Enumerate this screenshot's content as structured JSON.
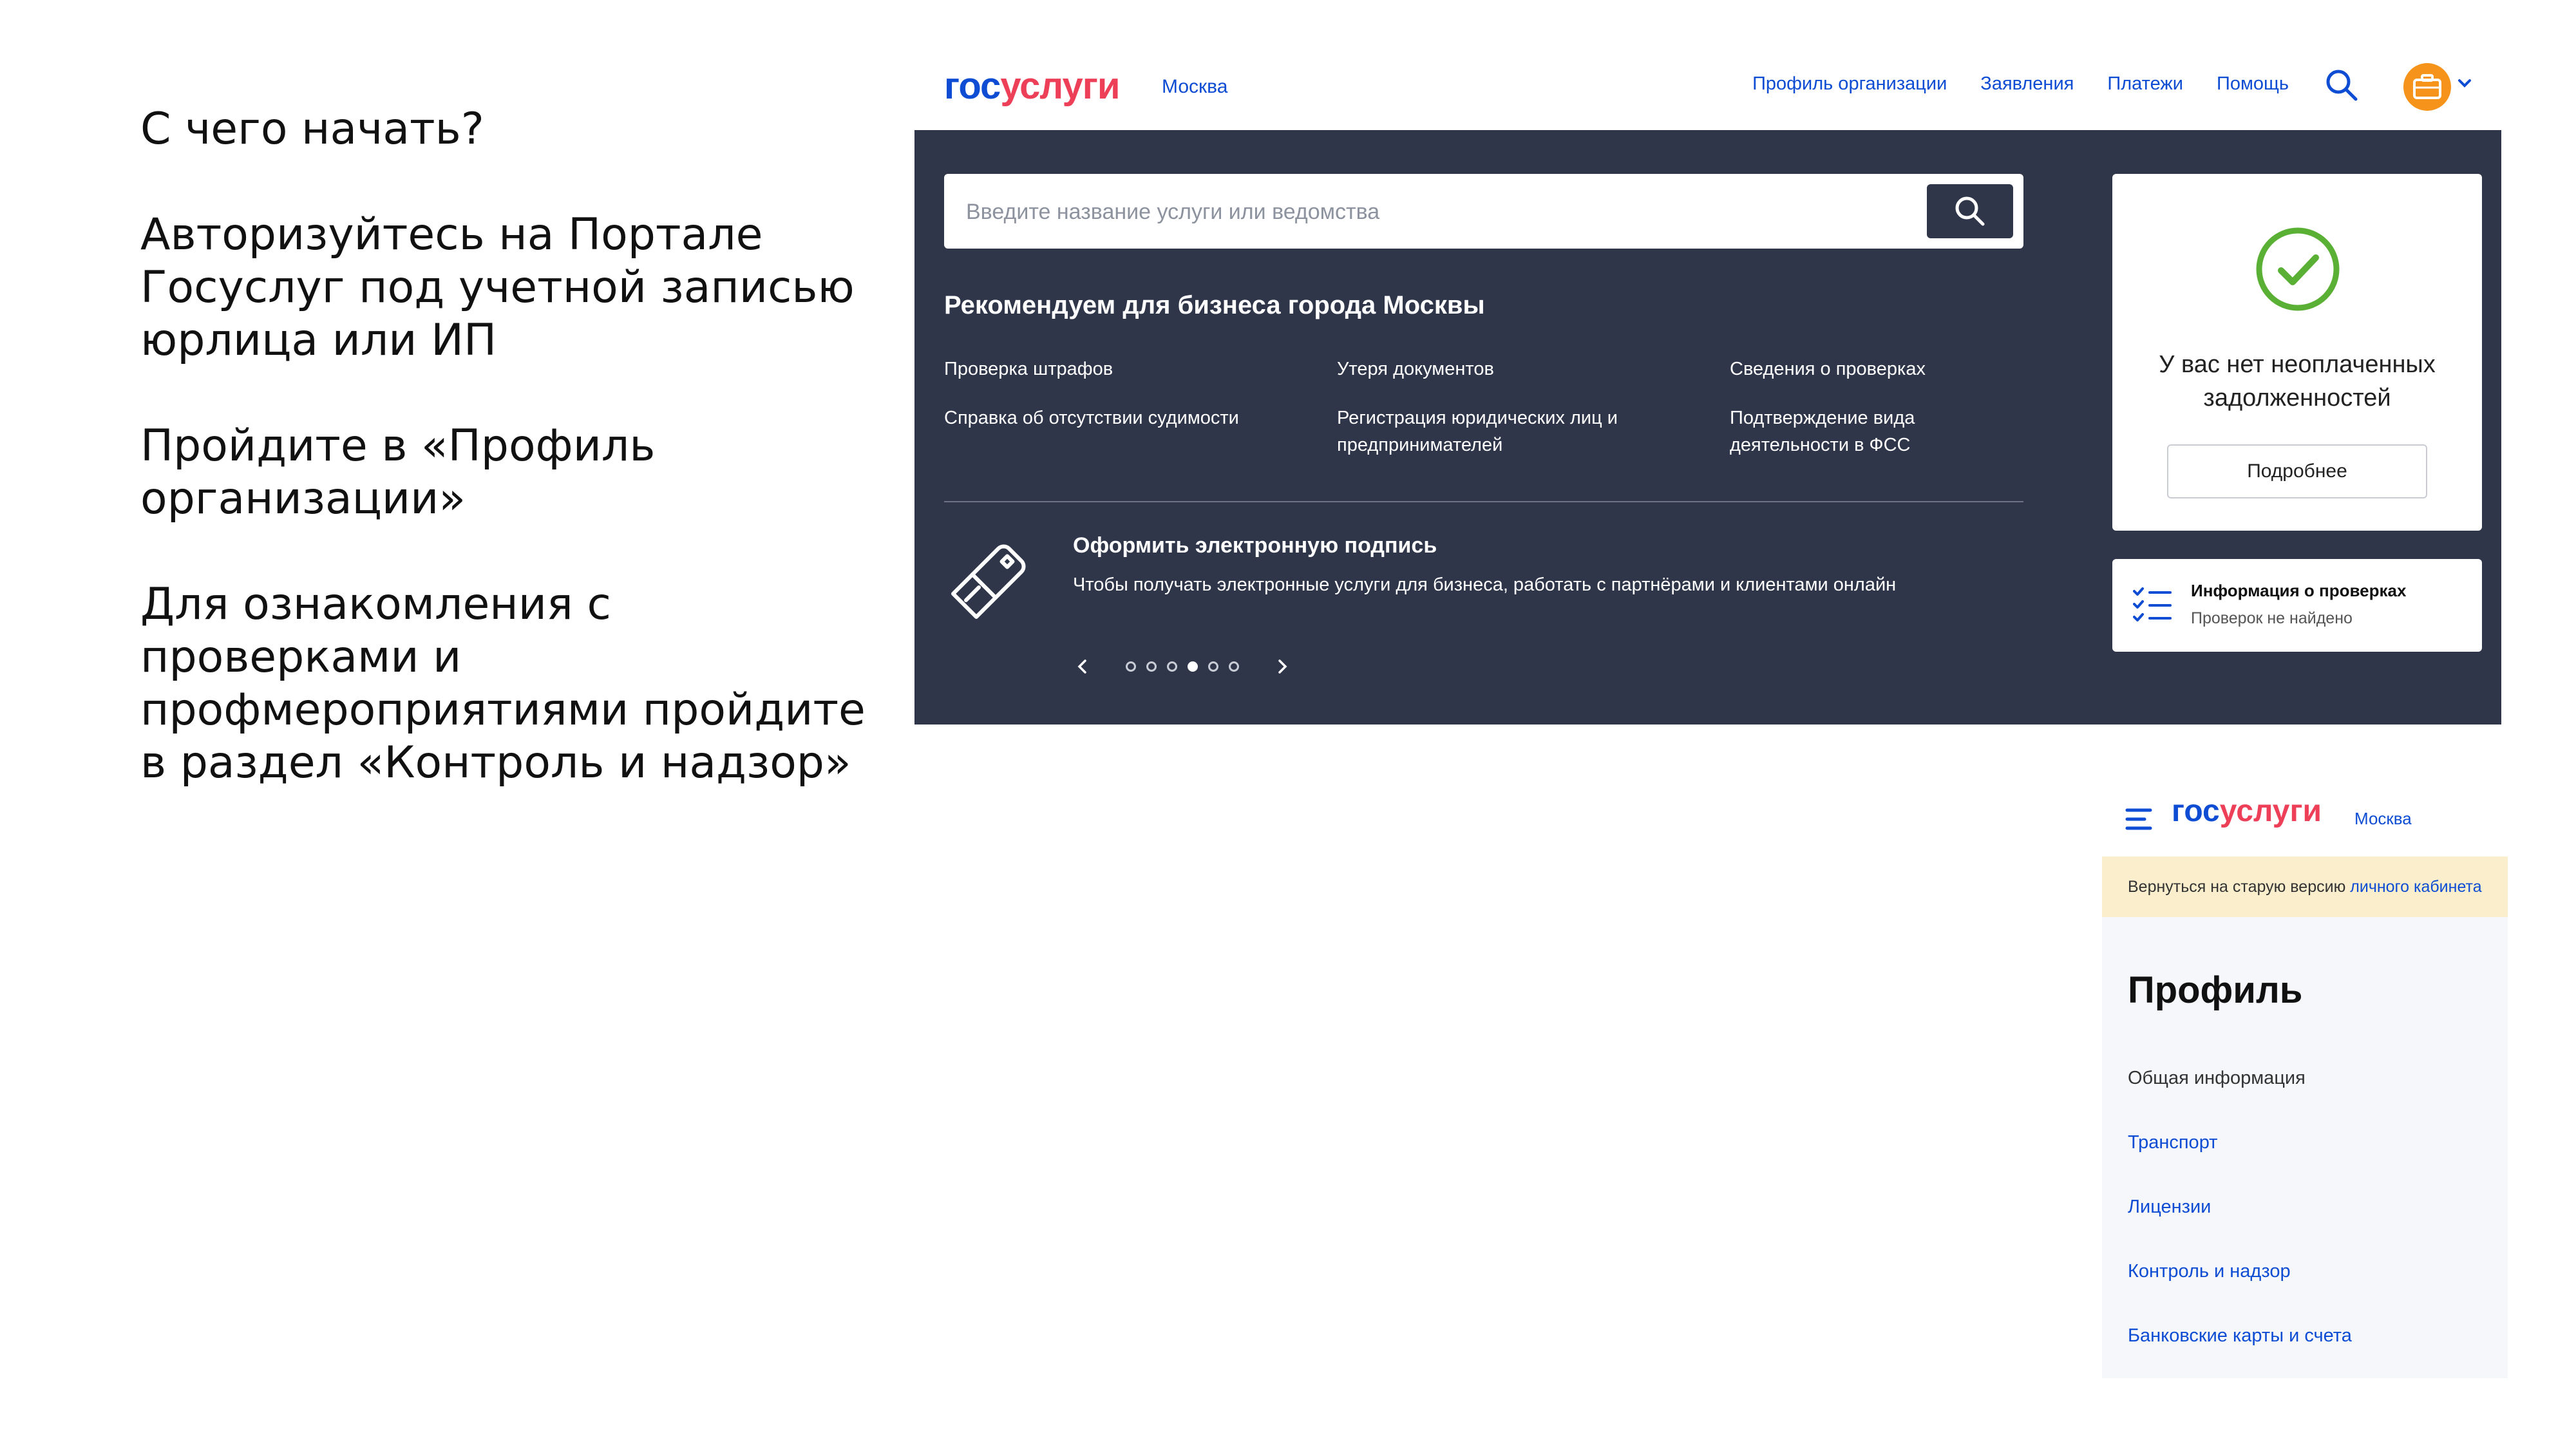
{
  "slide": {
    "heading": "С чего начать?",
    "step1": "Авторизуйтесь на Портале Госуслуг под учетной записью юрлица или ИП",
    "step2": "Пройдите в «Профиль организации»",
    "step3": "Для ознакомления с проверками и профмероприятиями пройдите в раздел «Контроль и надзор»"
  },
  "header": {
    "logo_part1": "гос",
    "logo_part2": "услуги",
    "city": "Москва",
    "nav": [
      "Профиль организации",
      "Заявления",
      "Платежи",
      "Помощь"
    ]
  },
  "search": {
    "placeholder": "Введите название услуги или ведомства"
  },
  "recommend": {
    "title": "Рекомендуем для бизнеса города Москвы",
    "items": [
      "Проверка штрафов",
      "Утеря документов",
      "Сведения о проверках",
      "Справка об отсутствии судимости",
      "Регистрация юридических лиц и предпринимателей",
      "Подтверждение вида деятельности в ФСС"
    ]
  },
  "promo": {
    "title": "Оформить электронную подпись",
    "subtitle": "Чтобы получать электронные услуги для бизнеса, работать с партнёрами и клиентами онлайн",
    "dots_total": 6,
    "dot_active": 4
  },
  "debt_card": {
    "text": "У вас нет неоплаченных задолженностей",
    "button": "Подробнее"
  },
  "inspection_card": {
    "title": "Информация о проверках",
    "subtitle": "Проверок не найдено"
  },
  "mobile": {
    "logo_part1": "гос",
    "logo_part2": "услуги",
    "city": "Москва",
    "banner_text": "Вернуться на старую версию ",
    "banner_link": "личного кабинета",
    "profile_title": "Профиль",
    "menu": [
      "Общая информация",
      "Транспорт",
      "Лицензии",
      "Контроль и надзор",
      "Банковские карты и счета"
    ]
  },
  "colors": {
    "brand_blue": "#0d4cd3",
    "brand_red": "#ee3f58",
    "panel_bg": "#2f3649",
    "success_green": "#5ab034",
    "avatar_orange": "#f5931b"
  }
}
